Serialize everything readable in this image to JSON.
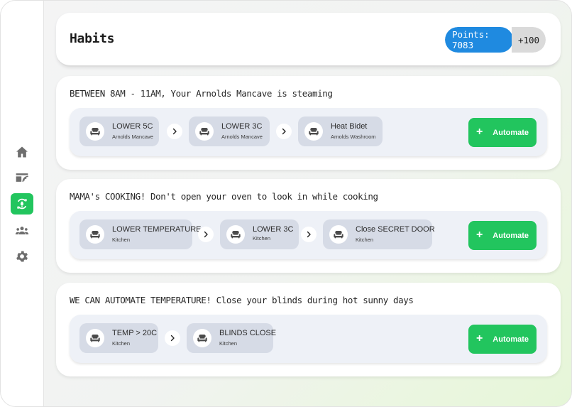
{
  "header": {
    "title": "Habits",
    "points_label": "Points: 7083",
    "bonus_label": "+100"
  },
  "colors": {
    "accent_green": "#22c55e",
    "points_blue": "#1f8ae0"
  },
  "nav": [
    {
      "name": "home",
      "icon": "home-icon"
    },
    {
      "name": "devices",
      "icon": "router-icon"
    },
    {
      "name": "habits",
      "icon": "automation-icon",
      "active": true
    },
    {
      "name": "family",
      "icon": "people-icon"
    },
    {
      "name": "settings",
      "icon": "gear-icon"
    }
  ],
  "habits": [
    {
      "title": "BETWEEN 8AM - 11AM, Your Arnolds Mancave is steaming",
      "steps": [
        {
          "label": "LOWER 5C",
          "location": "Arnolds Mancave",
          "icon": "armchair-icon"
        },
        {
          "label": "LOWER 3C",
          "location": "Arnolds Mancave",
          "icon": "armchair-icon"
        },
        {
          "label": "Heat Bidet",
          "location": "Arnolds Washroom",
          "icon": "armchair-icon"
        }
      ],
      "action_label": "Automate"
    },
    {
      "title": "MAMA's COOKING! Don't open your oven to look in while cooking",
      "steps": [
        {
          "label": "LOWER TEMPERATURE",
          "location": "Kitchen",
          "icon": "armchair-icon"
        },
        {
          "label": "LOWER 3C",
          "location": "Kitchen",
          "icon": "armchair-icon"
        },
        {
          "label": "Close SECRET DOOR",
          "location": "Kitchen",
          "icon": "armchair-icon"
        }
      ],
      "action_label": "Automate"
    },
    {
      "title": "WE CAN AUTOMATE TEMPERATURE! Close your blinds during hot sunny days",
      "steps": [
        {
          "label": "TEMP > 20C",
          "location": "Kitchen",
          "icon": "armchair-icon"
        },
        {
          "label": "BLINDS CLOSE",
          "location": "Kitchen",
          "icon": "armchair-icon"
        }
      ],
      "action_label": "Automate"
    }
  ]
}
